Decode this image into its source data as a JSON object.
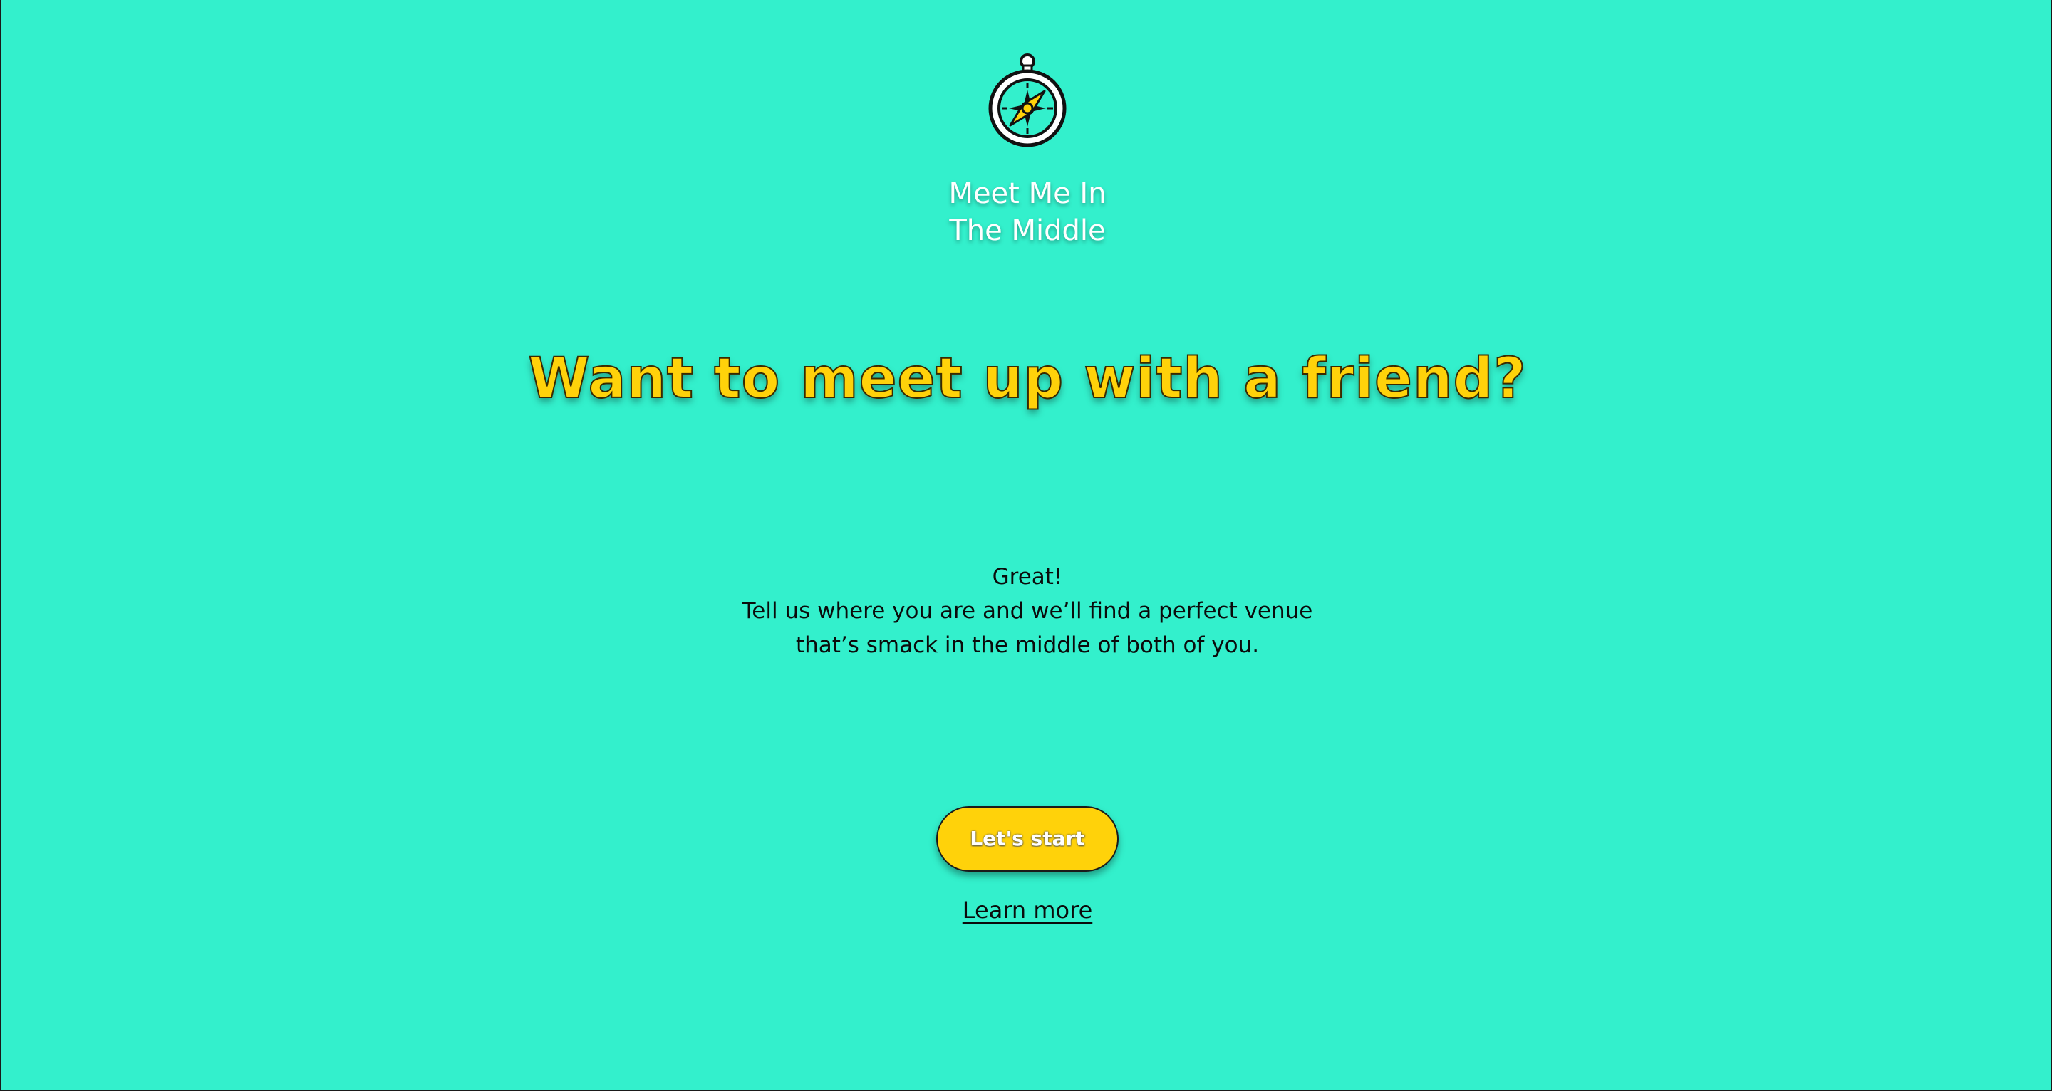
{
  "brand": {
    "logo_icon": "compass-icon",
    "name_line1": "Meet Me In",
    "name_line2": "The Middle"
  },
  "hero": {
    "headline": "Want to meet up with a friend?",
    "intro_line1": "Great!",
    "intro_line2": "Tell us where you are and we’ll find a perfect venue",
    "intro_line3": "that’s smack in the middle of both of you."
  },
  "actions": {
    "start_label": "Let's start",
    "learn_more_label": "Learn more"
  },
  "colors": {
    "background": "#33f0cc",
    "accent_yellow": "#ffd20a",
    "text_dark": "#0b0b0b",
    "brand_text": "#ffffff"
  }
}
